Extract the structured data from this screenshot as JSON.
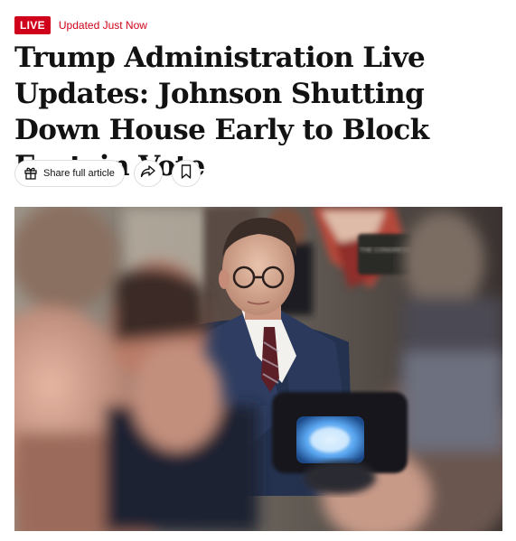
{
  "badge": {
    "label": "LIVE",
    "color": "#d0021b"
  },
  "status": {
    "text": "Updated Just Now"
  },
  "headline": {
    "text": "Trump Administration Live Updates: Johnson Shutting Down House Early to Block Epstein Vote"
  },
  "toolbar": {
    "share_full_label": "Share full article",
    "gift_icon": "gift-icon",
    "share_icon": "share-arrow-icon",
    "save_icon": "bookmark-icon"
  },
  "photo": {
    "kind": "news-photo",
    "background_sign_text": "THE CONGRESS"
  }
}
